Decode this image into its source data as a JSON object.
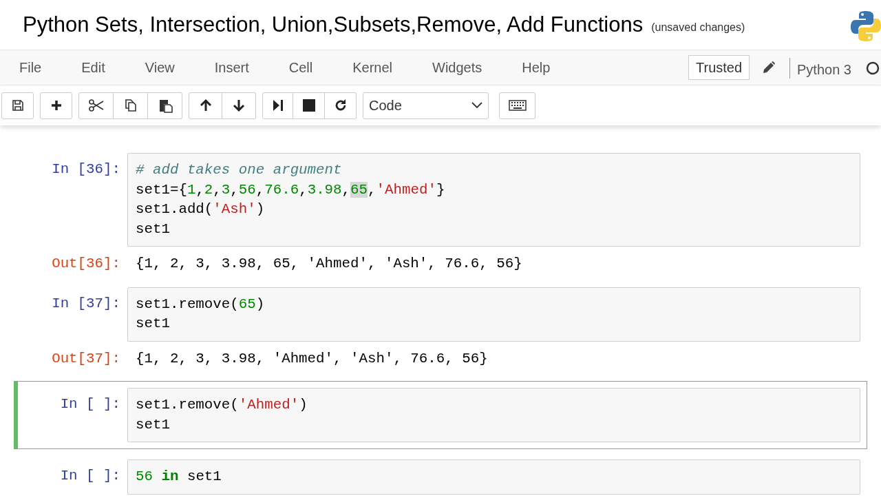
{
  "title": "Python Sets, Intersection, Union,Subsets,Remove, Add Functions",
  "save_status": "(unsaved changes)",
  "menu": [
    "File",
    "Edit",
    "View",
    "Insert",
    "Cell",
    "Kernel",
    "Widgets",
    "Help"
  ],
  "trusted": "Trusted",
  "kernel_name": "Python 3",
  "toolbar": {
    "cell_type": "Code"
  },
  "cells": [
    {
      "prompt": "In [36]:",
      "selected": false,
      "lines": [
        [
          {
            "kind": "comment",
            "text": "# add takes one argument"
          }
        ],
        [
          {
            "kind": "plain",
            "text": "set1={"
          },
          {
            "kind": "number",
            "text": "1"
          },
          {
            "kind": "plain",
            "text": ","
          },
          {
            "kind": "number",
            "text": "2"
          },
          {
            "kind": "plain",
            "text": ","
          },
          {
            "kind": "number",
            "text": "3"
          },
          {
            "kind": "plain",
            "text": ","
          },
          {
            "kind": "number",
            "text": "56"
          },
          {
            "kind": "plain",
            "text": ","
          },
          {
            "kind": "number",
            "text": "76.6"
          },
          {
            "kind": "plain",
            "text": ","
          },
          {
            "kind": "number",
            "text": "3.98"
          },
          {
            "kind": "plain",
            "text": ","
          },
          {
            "kind": "match",
            "text": "65"
          },
          {
            "kind": "plain",
            "text": ","
          },
          {
            "kind": "string",
            "text": "'Ahmed'"
          },
          {
            "kind": "plain",
            "text": "}"
          }
        ],
        [
          {
            "kind": "plain",
            "text": "set1.add("
          },
          {
            "kind": "string",
            "text": "'Ash'"
          },
          {
            "kind": "plain",
            "text": ")"
          }
        ],
        [
          {
            "kind": "plain",
            "text": "set1"
          }
        ]
      ],
      "output": {
        "prompt": "Out[36]:",
        "text": "{1, 2, 3, 3.98, 65, 'Ahmed', 'Ash', 76.6, 56}"
      }
    },
    {
      "prompt": "In [37]:",
      "selected": false,
      "lines": [
        [
          {
            "kind": "plain",
            "text": "set1.remove("
          },
          {
            "kind": "number",
            "text": "65"
          },
          {
            "kind": "plain",
            "text": ")"
          }
        ],
        [
          {
            "kind": "plain",
            "text": "set1"
          }
        ]
      ],
      "output": {
        "prompt": "Out[37]:",
        "text": "{1, 2, 3, 3.98, 'Ahmed', 'Ash', 76.6, 56}"
      }
    },
    {
      "prompt": "In [ ]:",
      "selected": true,
      "lines": [
        [
          {
            "kind": "plain",
            "text": "set1.remove("
          },
          {
            "kind": "string",
            "text": "'Ahmed'"
          },
          {
            "kind": "plain",
            "text": ")"
          }
        ],
        [
          {
            "kind": "plain",
            "text": "set1"
          }
        ]
      ]
    },
    {
      "prompt": "In [ ]:",
      "selected": false,
      "lines": [
        [
          {
            "kind": "number",
            "text": "56"
          },
          {
            "kind": "keyword",
            "text": " in"
          },
          {
            "kind": "plain",
            "text": " set1"
          }
        ]
      ]
    }
  ]
}
